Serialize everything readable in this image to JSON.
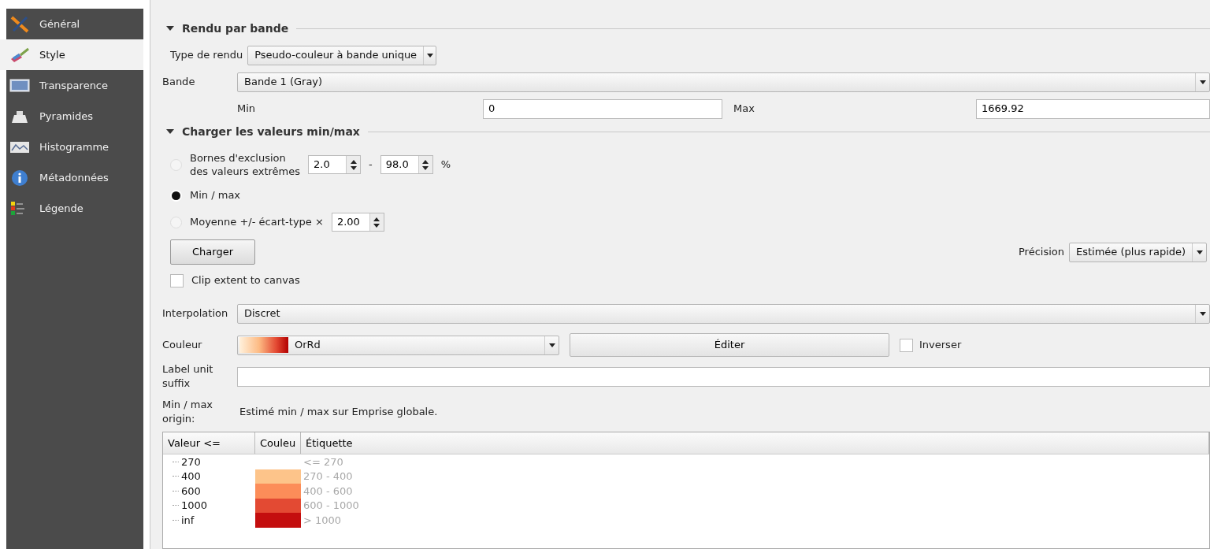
{
  "sidebar": {
    "items": [
      {
        "label": "Général",
        "kind": "tools",
        "selected": false
      },
      {
        "label": "Style",
        "kind": "brush",
        "selected": true
      },
      {
        "label": "Transparence",
        "kind": "screen",
        "selected": false
      },
      {
        "label": "Pyramides",
        "kind": "pyramid",
        "selected": false
      },
      {
        "label": "Histogramme",
        "kind": "chart",
        "selected": false
      },
      {
        "label": "Métadonnées",
        "kind": "info",
        "selected": false
      },
      {
        "label": "Légende",
        "kind": "legend",
        "selected": false
      }
    ]
  },
  "render_section": {
    "title": "Rendu par bande",
    "expanded": true,
    "render_type": {
      "label": "Type de rendu",
      "value": "Pseudo-couleur à bande unique"
    },
    "band": {
      "label": "Bande",
      "value": "Bande 1 (Gray)"
    },
    "min": {
      "label": "Min",
      "value": "0"
    },
    "max": {
      "label": "Max",
      "value": "1669.92"
    }
  },
  "minmax_section": {
    "title": "Charger les valeurs min/max",
    "expanded": true,
    "options": [
      {
        "kind": "range",
        "label": "Bornes d'exclusion des valeurs extrêmes",
        "selected": false,
        "from": "2.0",
        "separator": "-",
        "to": "98.0",
        "unit": "%"
      },
      {
        "kind": "plain",
        "label": "Min / max",
        "selected": true
      },
      {
        "kind": "factor",
        "label": "Moyenne +/- écart-type ×",
        "selected": false,
        "factor": "2.00"
      }
    ],
    "load_button": "Charger",
    "precision": {
      "label": "Précision",
      "value": "Estimée (plus rapide)"
    },
    "clip": {
      "label": "Clip extent to canvas",
      "checked": false
    }
  },
  "interpolation": {
    "label": "Interpolation",
    "value": "Discret"
  },
  "color_ramp": {
    "label": "Couleur",
    "value": "OrRd",
    "edit_button": "Éditer",
    "invert": {
      "label": "Inverser",
      "checked": false
    }
  },
  "unit_suffix": {
    "label": "Label unit suffix"
  },
  "origin": {
    "label": "Min / max origin:",
    "value": "Estimé min / max sur Emprise globale."
  },
  "table": {
    "columns": [
      "Valeur <=",
      "Couleu",
      "Étiquette"
    ],
    "rows": [
      {
        "value": "270",
        "label": "<= 270"
      },
      {
        "value": "400",
        "color": "#fdc48a",
        "label": "270 - 400"
      },
      {
        "value": "600",
        "color": "#fc8d59",
        "label": "400 - 600"
      },
      {
        "value": "1000",
        "color": "#e34a33",
        "label": "600 - 1000"
      },
      {
        "value": "inf",
        "color": "#c40e0e",
        "label": "> 1000"
      }
    ]
  }
}
